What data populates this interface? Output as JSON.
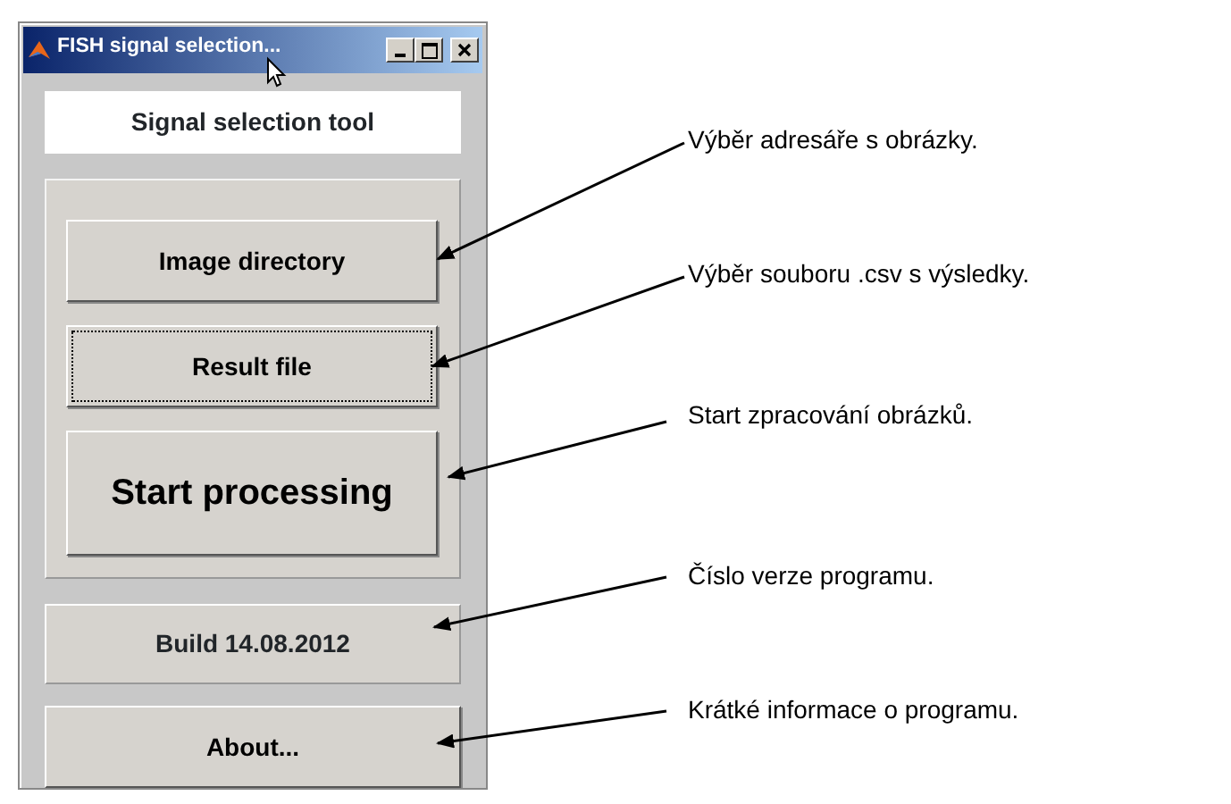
{
  "window": {
    "title": "FISH signal selection..."
  },
  "header": "Signal selection tool",
  "panel_buttons": [
    {
      "label": "Image directory",
      "kind": "normal",
      "focused": false
    },
    {
      "label": "Result file",
      "kind": "normal",
      "focused": true
    },
    {
      "label": "Start processing",
      "kind": "large",
      "focused": false
    }
  ],
  "build_label": "Build 14.08.2012",
  "about_button": {
    "label": "About..."
  },
  "annotations": [
    "Výběr adresáře s obrázky.",
    "Výběr souboru .csv s výsledky.",
    "Start zpracování obrázků.",
    "Číslo verze programu.",
    "Krátké informace o programu."
  ]
}
